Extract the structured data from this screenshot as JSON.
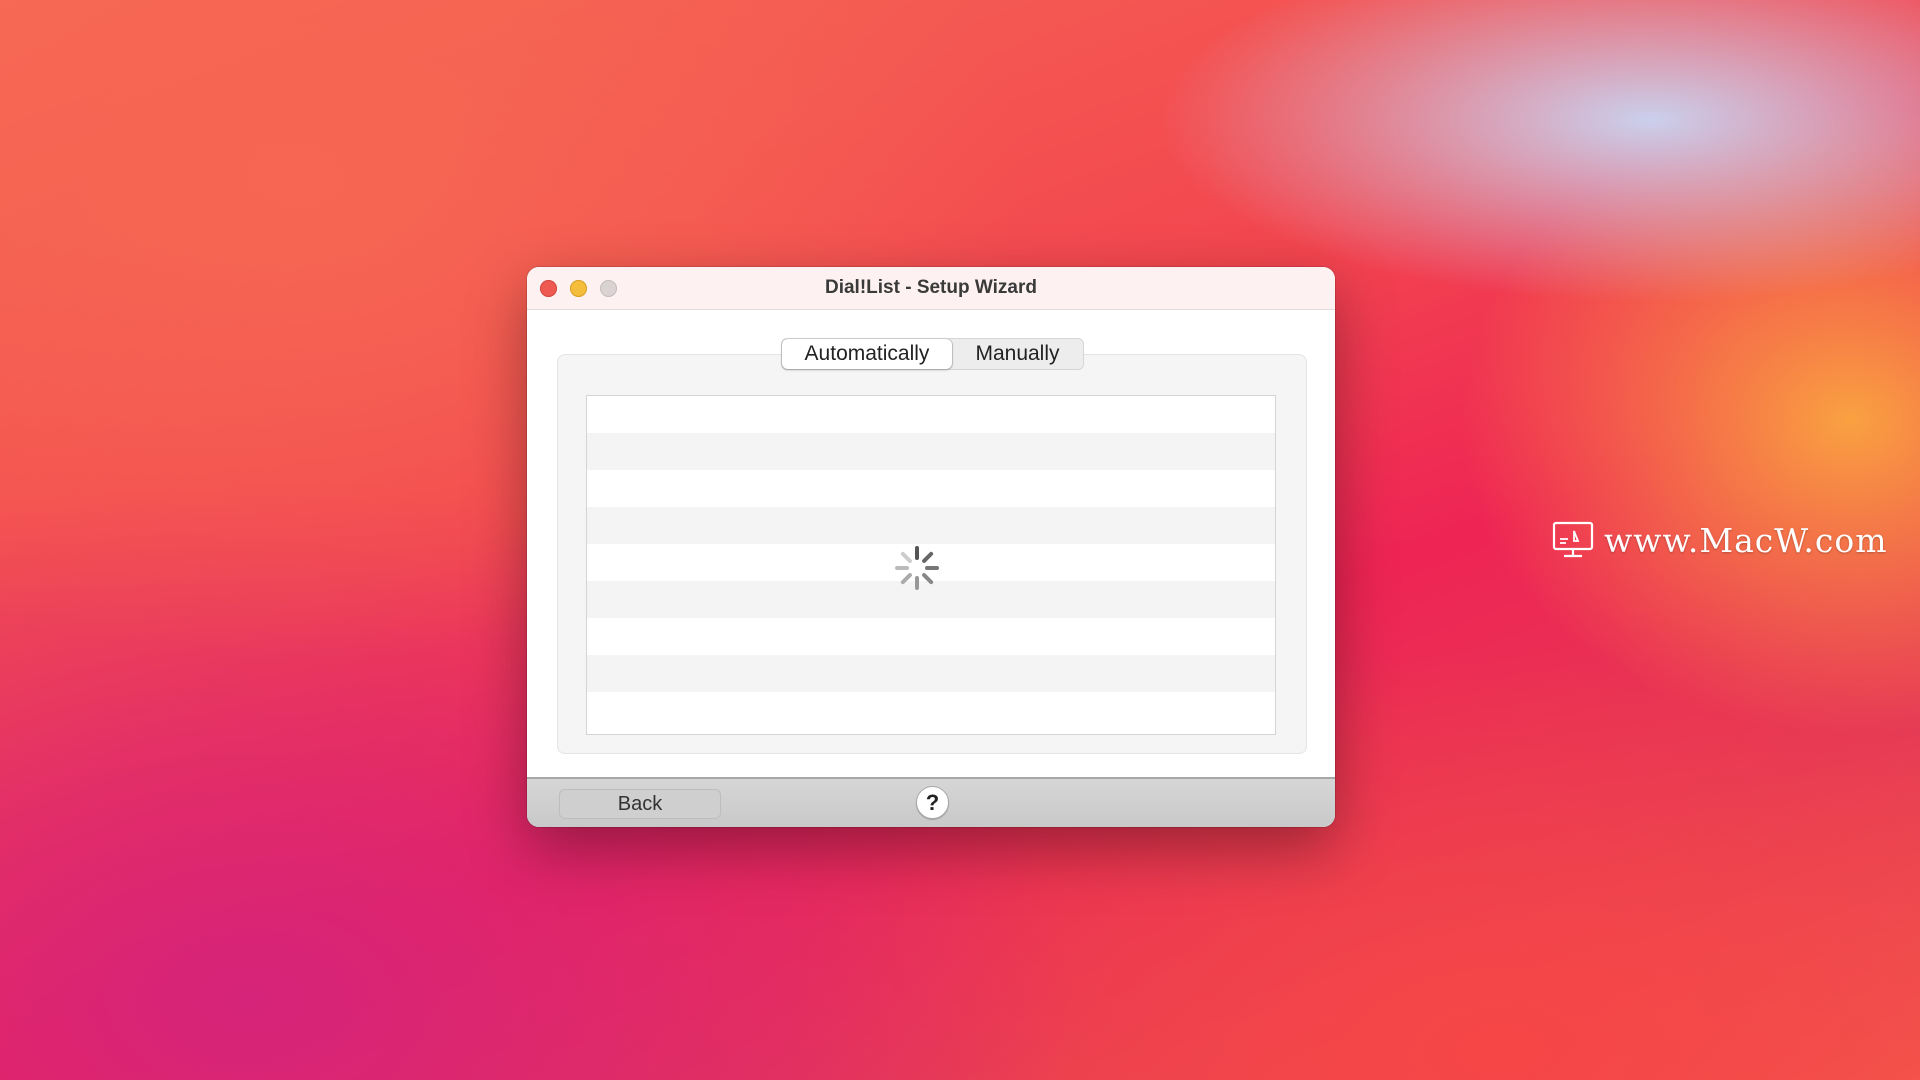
{
  "window": {
    "title": "Dial!List - Setup Wizard"
  },
  "tabs": [
    {
      "label": "Automatically",
      "selected": true
    },
    {
      "label": "Manually",
      "selected": false
    }
  ],
  "list": {
    "loading": true,
    "loading_indicator": "spinner-icon"
  },
  "footer": {
    "back_label": "Back",
    "help_label": "?"
  },
  "watermark": {
    "text": "www.MacW.com",
    "icon": "monitor-logo-icon"
  },
  "colors": {
    "close": "#ee5a52",
    "minimize": "#f4bd3c",
    "zoom": "#d9d4d3"
  }
}
